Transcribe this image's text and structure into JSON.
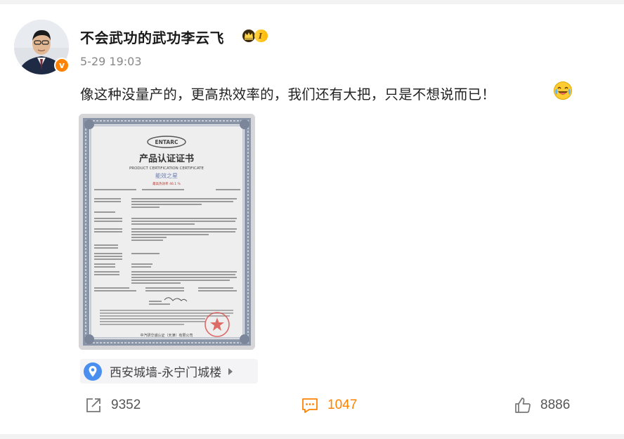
{
  "post": {
    "user_name": "不会武功的武功李云飞",
    "vip_level": "I",
    "verified_mark": "v",
    "time": "5-29 19:03",
    "text": "像这种没量产的，更高热效率的，我们还有大把，只是不想说而已！",
    "emoji_icon": "laugh-cry-emoji"
  },
  "certificate": {
    "brand": "ENTARC",
    "title_cn": "产品认证证书",
    "title_en": "PRODUCT CERTIFICATION CERTIFICATE",
    "subtitle": "能效之星",
    "subtitle2": "最高热效率 46.1 %",
    "footer": "中汽研华诚认证（天津）有限公司",
    "seal_text": "认证专用章"
  },
  "location": {
    "label": "西安城墙-永宁门城楼"
  },
  "actions": {
    "repost_count": "9352",
    "comment_count": "1047",
    "like_count": "8886"
  },
  "colors": {
    "accent_orange": "#ff8200",
    "location_blue": "#4a8ef0",
    "text_gray": "#888888"
  }
}
